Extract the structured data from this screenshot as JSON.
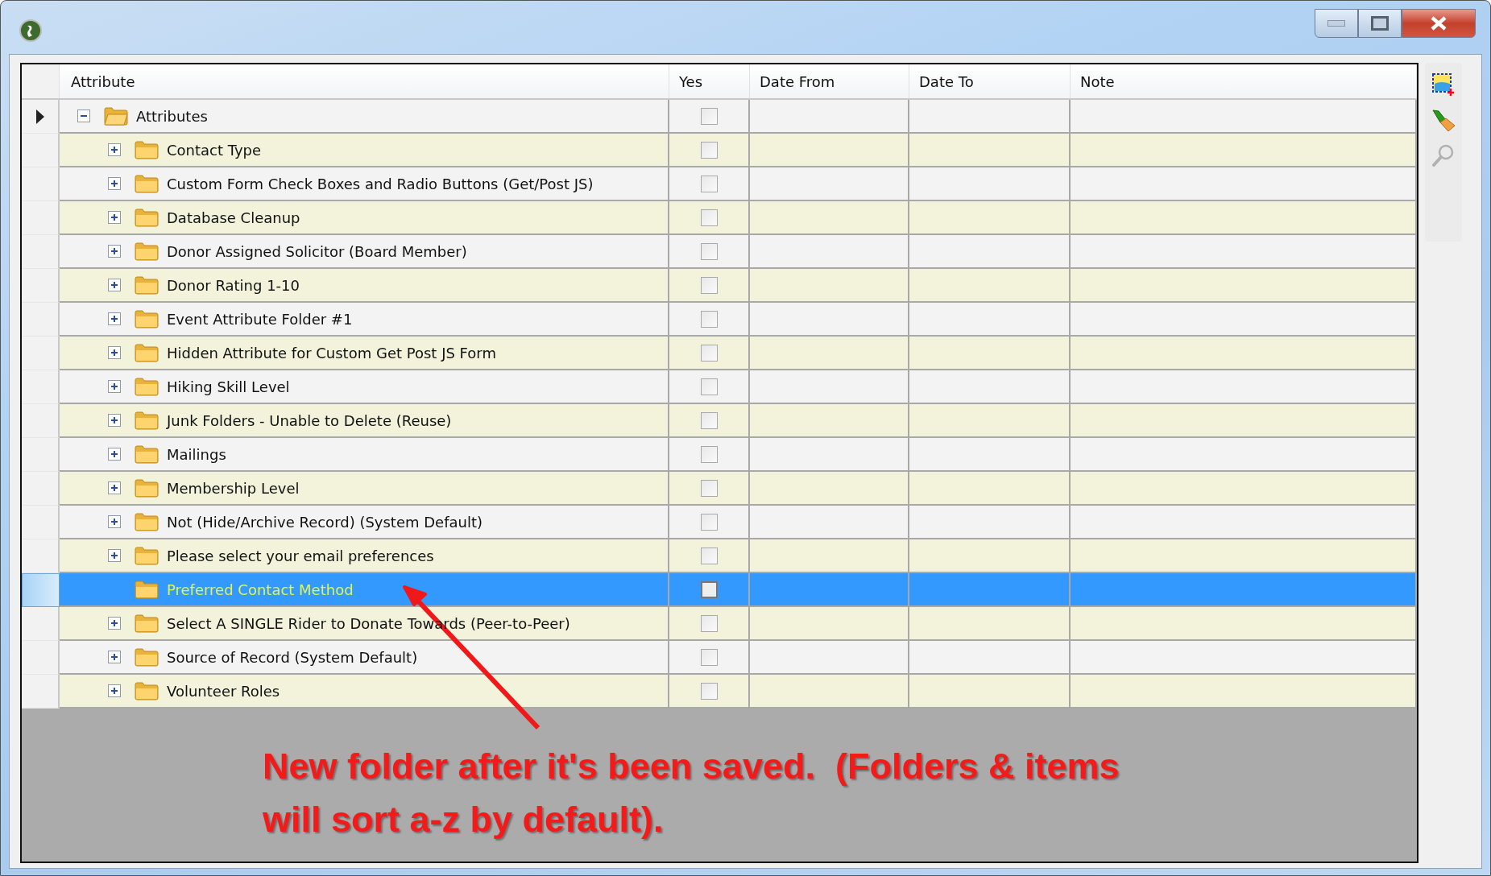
{
  "grid": {
    "columns": [
      "Attribute",
      "Yes",
      "Date From",
      "Date To",
      "Note"
    ],
    "tree": {
      "label": "Attributes",
      "current": true,
      "expandable": true,
      "expanded": true,
      "checked": false,
      "children": [
        {
          "label": "Contact Type",
          "expandable": true,
          "checked": false,
          "selected": false
        },
        {
          "label": "Custom Form Check Boxes and Radio Buttons (Get/Post JS)",
          "expandable": true,
          "checked": false,
          "selected": false
        },
        {
          "label": "Database Cleanup",
          "expandable": true,
          "checked": false,
          "selected": false
        },
        {
          "label": "Donor Assigned Solicitor (Board Member)",
          "expandable": true,
          "checked": false,
          "selected": false
        },
        {
          "label": "Donor Rating 1-10",
          "expandable": true,
          "checked": false,
          "selected": false
        },
        {
          "label": "Event Attribute Folder #1",
          "expandable": true,
          "checked": false,
          "selected": false
        },
        {
          "label": "Hidden Attribute for Custom Get Post JS Form",
          "expandable": true,
          "checked": false,
          "selected": false
        },
        {
          "label": "Hiking Skill Level",
          "expandable": true,
          "checked": false,
          "selected": false
        },
        {
          "label": "Junk Folders - Unable to Delete (Reuse)",
          "expandable": true,
          "checked": false,
          "selected": false
        },
        {
          "label": "Mailings",
          "expandable": true,
          "checked": false,
          "selected": false
        },
        {
          "label": "Membership Level",
          "expandable": true,
          "checked": false,
          "selected": false
        },
        {
          "label": "Not (Hide/Archive Record) (System Default)",
          "expandable": true,
          "checked": false,
          "selected": false
        },
        {
          "label": "Please select your email preferences",
          "expandable": true,
          "checked": false,
          "selected": false
        },
        {
          "label": "Preferred Contact Method",
          "expandable": false,
          "checked": false,
          "selected": true
        },
        {
          "label": "Select A SINGLE Rider to Donate Towards (Peer-to-Peer)",
          "expandable": true,
          "checked": false,
          "selected": false
        },
        {
          "label": "Source of Record (System Default)",
          "expandable": true,
          "checked": false,
          "selected": false
        },
        {
          "label": "Volunteer Roles",
          "expandable": true,
          "checked": false,
          "selected": false
        }
      ]
    }
  },
  "toolbar": [
    {
      "kind": "add-image",
      "disabled": false
    },
    {
      "kind": "broom",
      "disabled": false
    },
    {
      "kind": "search",
      "disabled": true
    }
  ],
  "annotation": {
    "lines": [
      "New folder after it's been saved.  (Folders & items",
      "will sort a-z by default)."
    ]
  }
}
